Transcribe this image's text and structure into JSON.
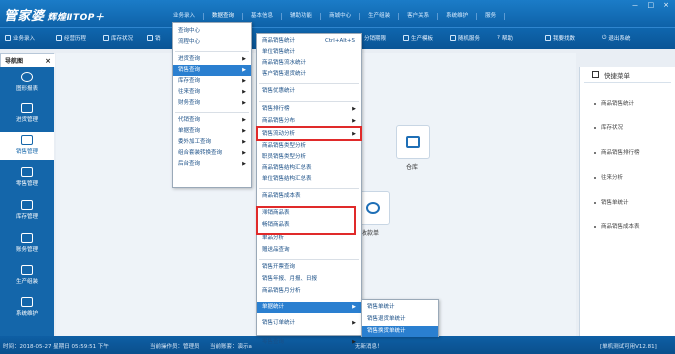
{
  "app": {
    "logo": "管家婆",
    "edition": "辉煌ⅡTOP＋"
  },
  "window_buttons": [
    "－",
    "□",
    "×"
  ],
  "top_menu": [
    "业务录入",
    "数据查询",
    "基本信息",
    "辅助功能",
    "商城中心",
    "生产组装",
    "客户关系",
    "系统维护",
    "服务"
  ],
  "toolbar": [
    "业务录入",
    "经营历程",
    "库存状况",
    "销",
    "分销期限",
    "生产模板",
    "随机服务",
    "帮助",
    "我要找数",
    "退出系统"
  ],
  "tab": {
    "label": "导航图",
    "close": "×"
  },
  "nav": [
    "图形报表",
    "进货管理",
    "销售管理",
    "零售管理",
    "库存管理",
    "账务管理",
    "生产组装",
    "系统维护"
  ],
  "modules": {
    "warehouse": "仓库",
    "receipt": "收款单"
  },
  "quick": {
    "title": "快捷菜单",
    "items": [
      "商品销售统计",
      "库存状况",
      "商品销售排行榜",
      "往来分析",
      "销售单统计",
      "商品销售成本表"
    ]
  },
  "menu1": [
    "查询中心",
    "流程中心",
    "进货查询",
    "销售查询",
    "库存查询",
    "往来查询",
    "财务查询",
    "代销查询",
    "单据查询",
    "委外加工查询",
    "组合套装转换查询",
    "后台查询"
  ],
  "menu2": {
    "items": [
      "商品销售统计",
      "单位销售统计",
      "商品销售流水统计",
      "客户销售退货统计",
      "销售优惠统计",
      "销售排行榜",
      "商品销售分布",
      "销售流动分析",
      "商品销售类型分析",
      "职员销售类型分析",
      "商品销售结构汇总表",
      "单位销售结构汇总表",
      "商品销售成本表",
      "滞销商品表",
      "畅销商品表",
      "单品分析",
      "赠送品查询",
      "销售开票查询",
      "销售年报、月报、日报",
      "商品销售月分析",
      "单据统计",
      "销售订单统计",
      "零售查询"
    ],
    "shortcut": "Ctrl+Alt+S"
  },
  "menu3": [
    "销售单统计",
    "销售退货单统计",
    "销售换货单统计"
  ],
  "status": {
    "time": "时间：2018-05-27 星期日 05:59:51 下午",
    "operator": "当前操作员：管理员",
    "company": "当前账套：演示a",
    "msg": "无新消息！",
    "version": "[单机测试可用V12.81]"
  }
}
